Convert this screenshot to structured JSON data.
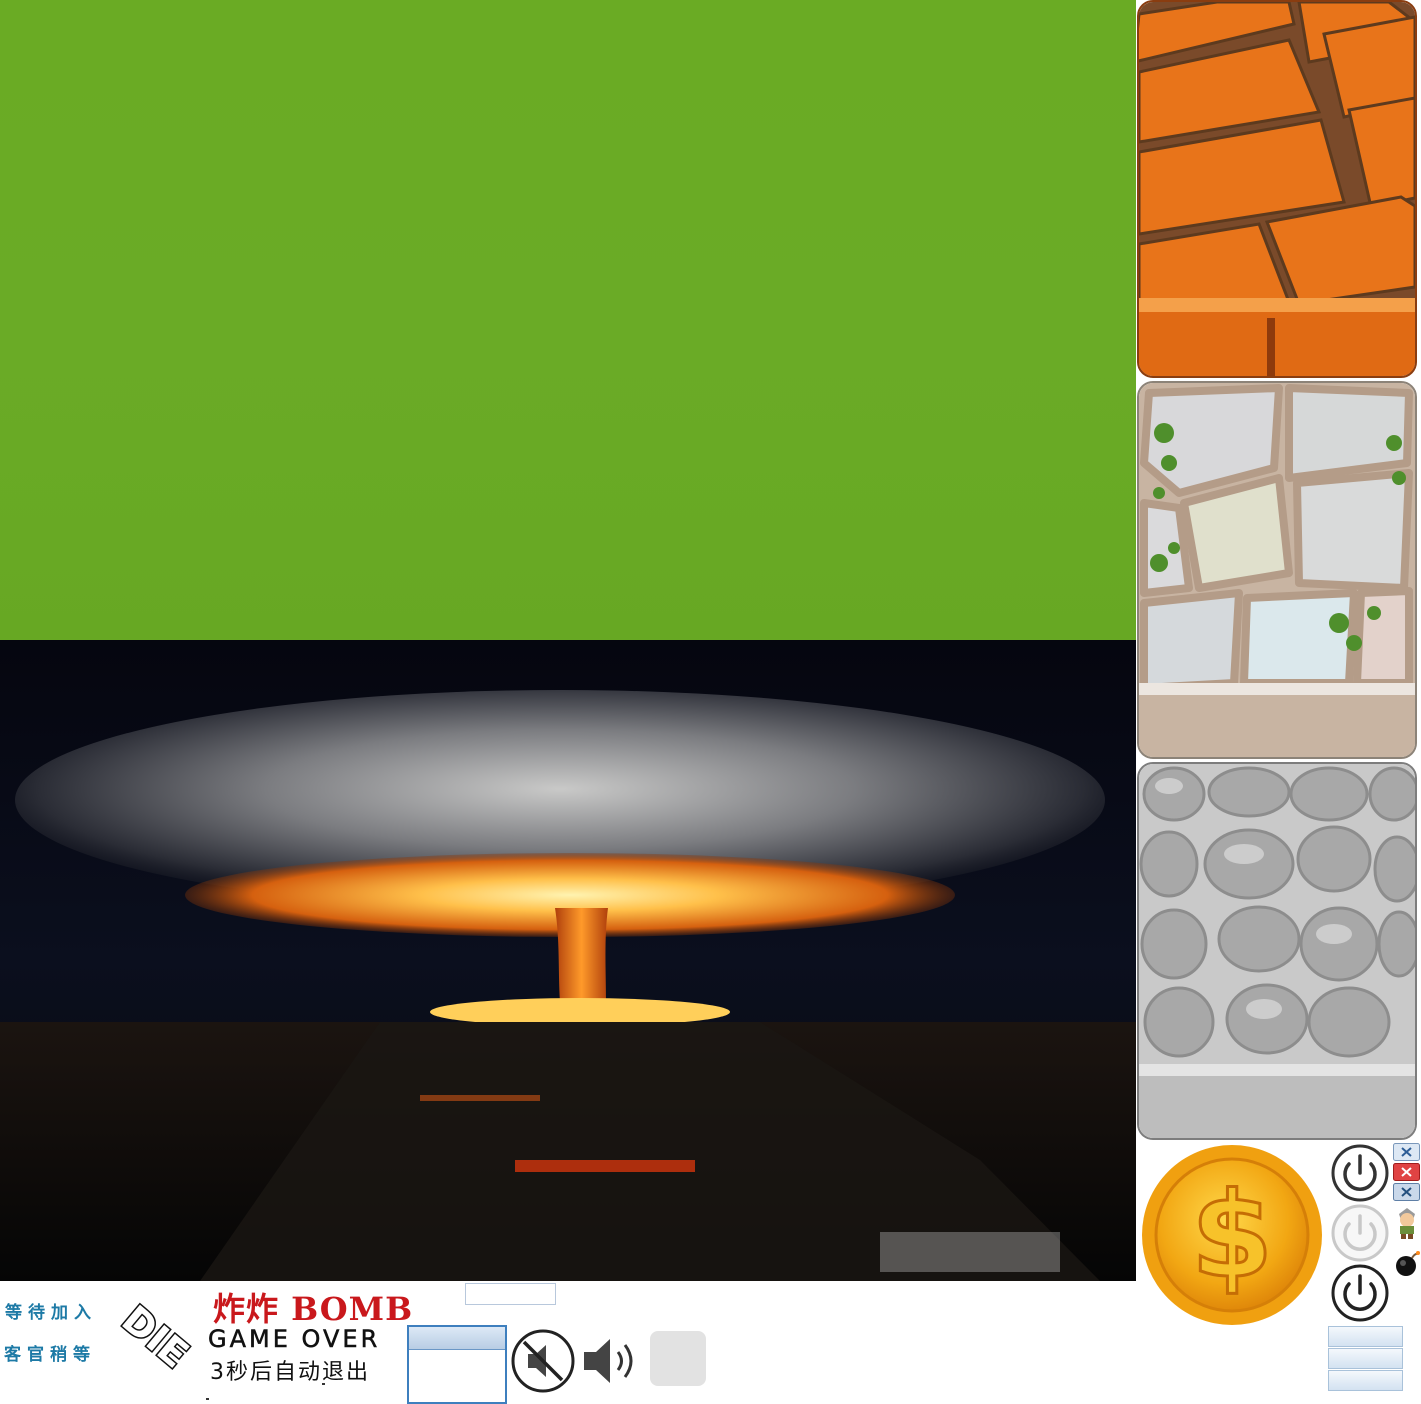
{
  "status": {
    "waiting_join": "等待加入",
    "please_wait": "客官稍等"
  },
  "die_label": "DIE",
  "title": "炸炸 BOMB",
  "game_over": "GAME OVER",
  "auto_exit": "3秒后自动退出",
  "name_input": {
    "value": ""
  },
  "icons": {
    "coin": "dollar-coin-icon",
    "power": "power-icon",
    "close": "close-icon",
    "mute": "speaker-muted-icon",
    "sound": "speaker-on-icon",
    "bomber": "bomber-character-icon",
    "bomb": "bomb-icon"
  },
  "colors": {
    "grass": "#6aab24",
    "title_red": "#c9181c",
    "status_blue": "#1d7aa6",
    "coin_gold": "#f2a713",
    "brick_orange": "#e8741a"
  }
}
